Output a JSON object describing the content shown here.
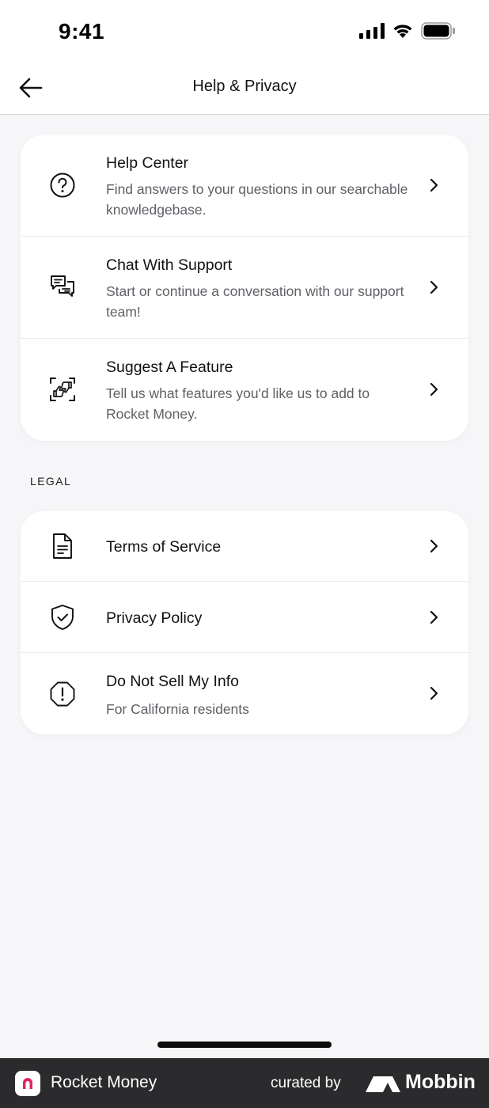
{
  "status_bar": {
    "time": "9:41"
  },
  "nav": {
    "title": "Help & Privacy"
  },
  "help_items": [
    {
      "title": "Help Center",
      "subtitle": "Find answers to your questions in our searchable knowledgebase."
    },
    {
      "title": "Chat With Support",
      "subtitle": "Start or continue a conversation with our support team!"
    },
    {
      "title": "Suggest A Feature",
      "subtitle": "Tell us what features you'd like us to add to Rocket Money."
    }
  ],
  "legal": {
    "section_label": "LEGAL",
    "items": [
      {
        "title": "Terms of Service"
      },
      {
        "title": "Privacy Policy"
      },
      {
        "title": "Do Not Sell My Info",
        "subtitle": "For California residents"
      }
    ]
  },
  "footer": {
    "brand": "Rocket Money",
    "curated_by": "curated by",
    "mobbin": "Mobbin"
  },
  "icons": {
    "help_center": "question-circle-icon",
    "chat": "chat-bubbles-icon",
    "suggest": "thumbs-feedback-icon",
    "terms": "document-icon",
    "privacy": "shield-check-icon",
    "do_not_sell": "alert-octagon-icon",
    "row_chevron": "chevron-right-icon",
    "back": "arrow-left-icon"
  },
  "colors": {
    "background": "#f6f5f8",
    "card": "#ffffff",
    "footer": "#2b2b2e",
    "brand_accent": "#e0245e"
  }
}
